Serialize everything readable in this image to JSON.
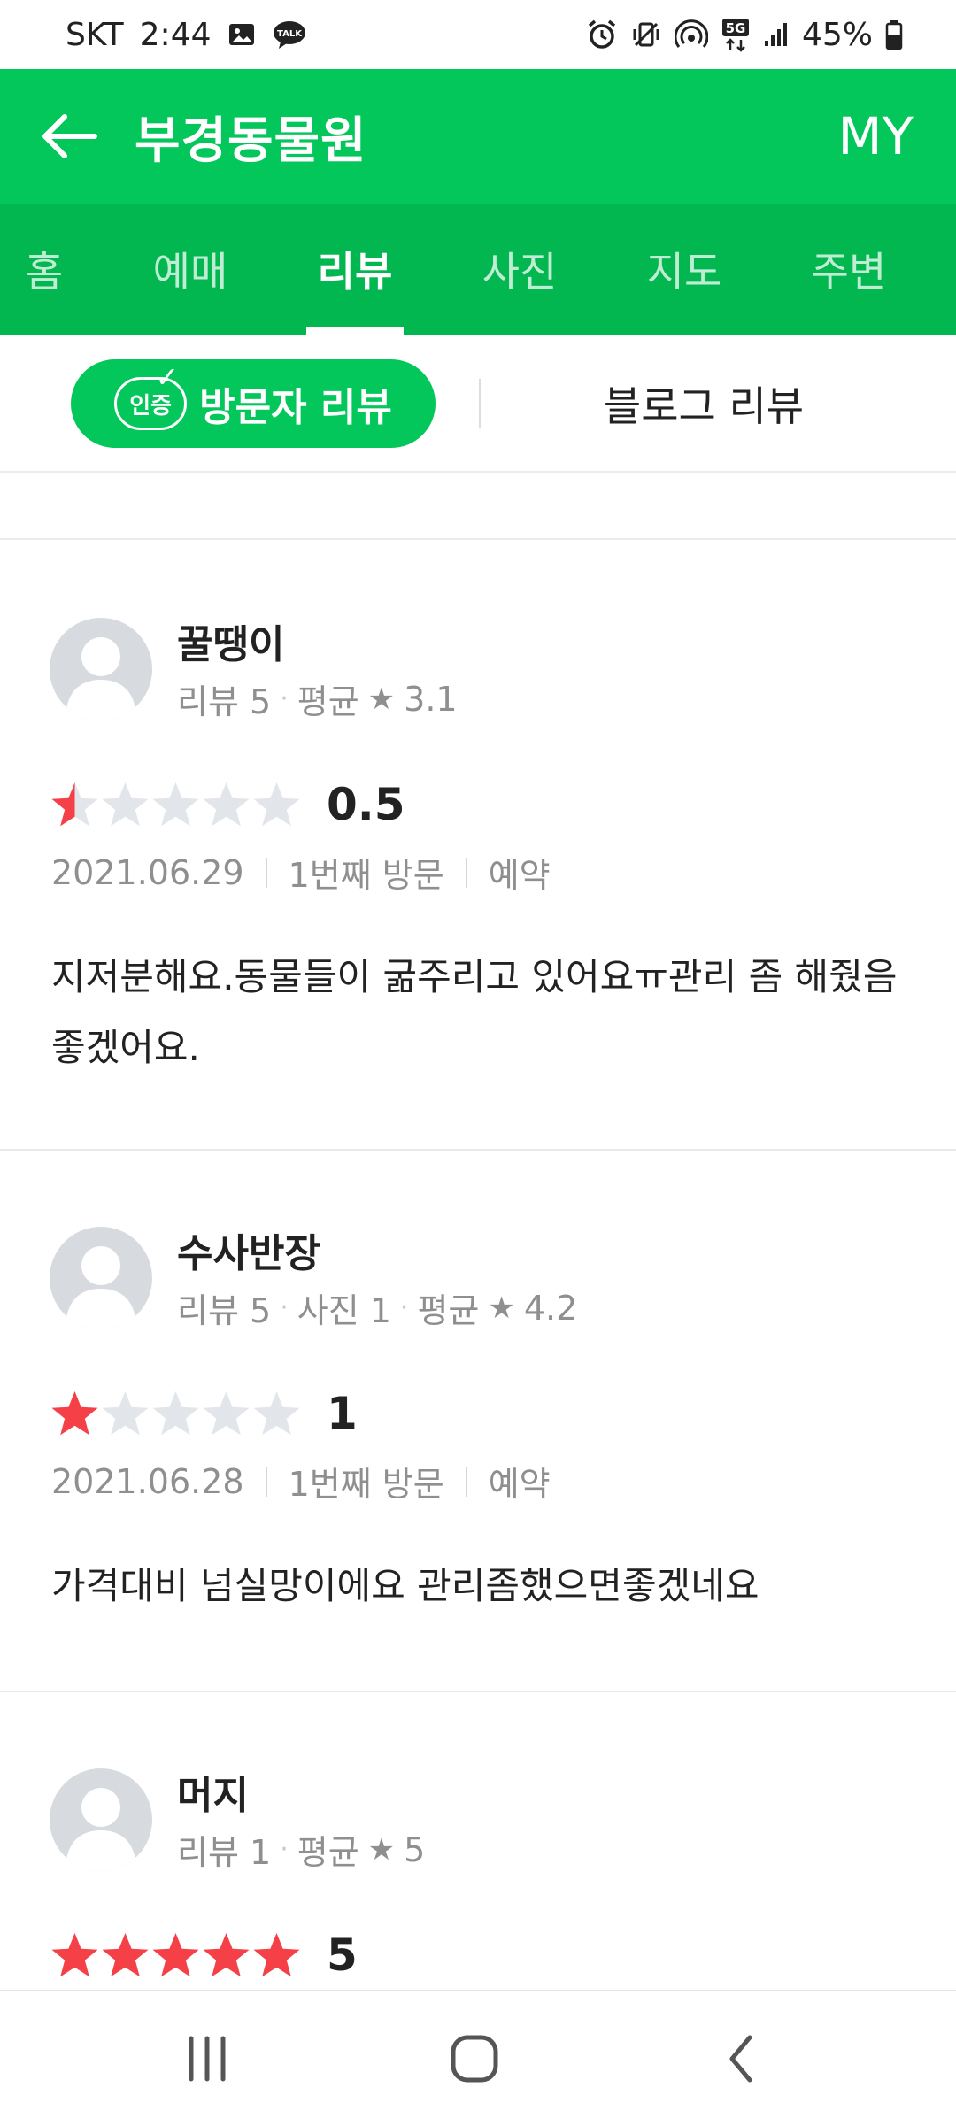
{
  "status_bar": {
    "carrier": "SKT",
    "time": "2:44",
    "battery": "45%",
    "left_icons": [
      "image-icon",
      "talk-icon"
    ],
    "right_icons": [
      "alarm-icon",
      "vibrate-icon",
      "hotspot-icon",
      "5g-icon",
      "signal-icon",
      "battery-icon"
    ]
  },
  "header": {
    "title": "부경동물원",
    "my_label": "MY",
    "back_icon": "back-arrow-icon"
  },
  "tabs": [
    {
      "label": "홈",
      "active": false
    },
    {
      "label": "예매",
      "active": false
    },
    {
      "label": "리뷰",
      "active": true
    },
    {
      "label": "사진",
      "active": false
    },
    {
      "label": "지도",
      "active": false
    },
    {
      "label": "주변",
      "active": false
    }
  ],
  "review_switch": {
    "visitor_label": "방문자 리뷰",
    "cert_badge": "인증",
    "blog_label": "블로그 리뷰"
  },
  "reviews": [
    {
      "name": "꿀땡이",
      "meta": {
        "reviews": "리뷰 5",
        "photos": "",
        "average": "평균",
        "average_value": "3.1"
      },
      "rating": 0.5,
      "rating_label": "0.5",
      "date": "2021.06.29",
      "visit": "1번째 방문",
      "type": "예약",
      "text": "지저분해요.동물들이 굶주리고 있어요ㅠ관리 좀 해줬음 좋겠어요."
    },
    {
      "name": "수사반장",
      "meta": {
        "reviews": "리뷰 5",
        "photos": "사진 1",
        "average": "평균",
        "average_value": "4.2"
      },
      "rating": 1,
      "rating_label": "1",
      "date": "2021.06.28",
      "visit": "1번째 방문",
      "type": "예약",
      "text": "가격대비 넘실망이에요 관리좀했으면좋겠네요"
    },
    {
      "name": "머지",
      "meta": {
        "reviews": "리뷰 1",
        "photos": "",
        "average": "평균",
        "average_value": "5"
      },
      "rating": 5,
      "rating_label": "5",
      "date": "",
      "visit": "",
      "type": "",
      "text": ""
    }
  ],
  "colors": {
    "brand_green": "#03c75a",
    "tab_green": "#02b74f",
    "star_red": "#f44046",
    "star_empty": "#e2e5ea"
  },
  "bottom_nav": {
    "icons": [
      "recent-apps-icon",
      "home-icon",
      "back-icon"
    ]
  }
}
